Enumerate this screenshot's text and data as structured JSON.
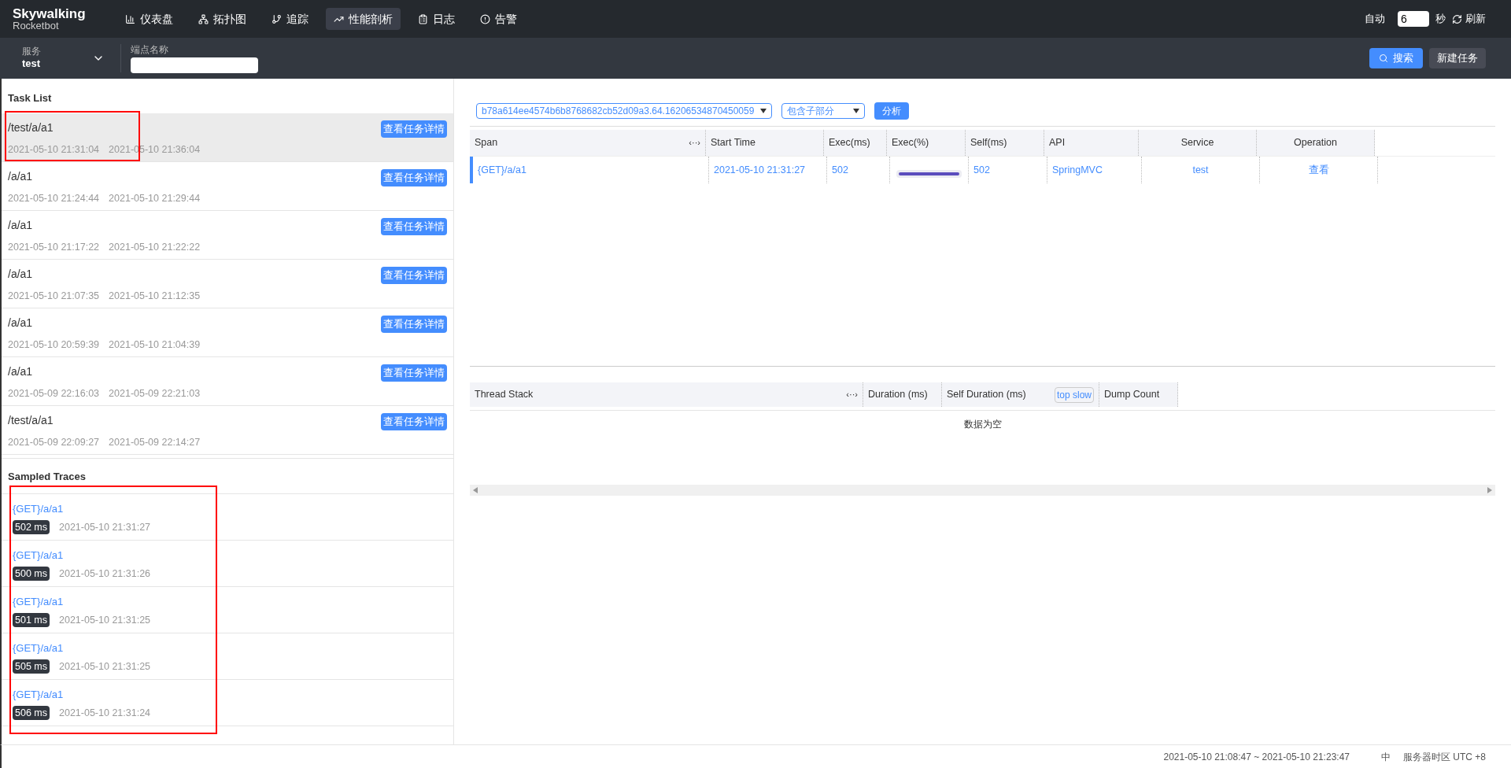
{
  "brand": {
    "name": "Skywalking",
    "subtitle": "Rocketbot"
  },
  "nav": [
    {
      "label": "仪表盘",
      "selected": false
    },
    {
      "label": "拓扑图",
      "selected": false
    },
    {
      "label": "追踪",
      "selected": false
    },
    {
      "label": "性能剖析",
      "selected": true
    },
    {
      "label": "日志",
      "selected": false
    },
    {
      "label": "告警",
      "selected": false
    }
  ],
  "auto_refresh": {
    "label": "自动",
    "value": "6",
    "unit": "秒",
    "refresh": "刷新"
  },
  "filters": {
    "service_label": "服务",
    "service_value": "test",
    "endpoint_label": "端点名称"
  },
  "actions": {
    "search": "搜索",
    "new_task": "新建任务"
  },
  "task_list": {
    "title": "Task List",
    "items": [
      {
        "endpoint": "/test/a/a1",
        "start": "2021-05-10 21:31:04",
        "end": "2021-05-10 21:36:04",
        "button": "查看任务详情",
        "selected": true
      },
      {
        "endpoint": "/a/a1",
        "start": "2021-05-10 21:24:44",
        "end": "2021-05-10 21:29:44",
        "button": "查看任务详情",
        "selected": false
      },
      {
        "endpoint": "/a/a1",
        "start": "2021-05-10 21:17:22",
        "end": "2021-05-10 21:22:22",
        "button": "查看任务详情",
        "selected": false
      },
      {
        "endpoint": "/a/a1",
        "start": "2021-05-10 21:07:35",
        "end": "2021-05-10 21:12:35",
        "button": "查看任务详情",
        "selected": false
      },
      {
        "endpoint": "/a/a1",
        "start": "2021-05-10 20:59:39",
        "end": "2021-05-10 21:04:39",
        "button": "查看任务详情",
        "selected": false
      },
      {
        "endpoint": "/a/a1",
        "start": "2021-05-09 22:16:03",
        "end": "2021-05-09 22:21:03",
        "button": "查看任务详情",
        "selected": false
      },
      {
        "endpoint": "/test/a/a1",
        "start": "2021-05-09 22:09:27",
        "end": "2021-05-09 22:14:27",
        "button": "查看任务详情",
        "selected": false
      }
    ]
  },
  "sampled_traces": {
    "title": "Sampled Traces",
    "items": [
      {
        "name": "{GET}/a/a1",
        "duration": "502 ms",
        "time": "2021-05-10 21:31:27"
      },
      {
        "name": "{GET}/a/a1",
        "duration": "500 ms",
        "time": "2021-05-10 21:31:26"
      },
      {
        "name": "{GET}/a/a1",
        "duration": "501 ms",
        "time": "2021-05-10 21:31:25"
      },
      {
        "name": "{GET}/a/a1",
        "duration": "505 ms",
        "time": "2021-05-10 21:31:25"
      },
      {
        "name": "{GET}/a/a1",
        "duration": "506 ms",
        "time": "2021-05-10 21:31:24"
      }
    ]
  },
  "analysis": {
    "segment": "b78a614ee4574b6b8768682cb52d09a3.64.16206534870450059",
    "mode": "包含子部分",
    "button": "分析"
  },
  "span_table": {
    "columns": [
      "Span",
      "Start Time",
      "Exec(ms)",
      "Exec(%)",
      "Self(ms)",
      "API",
      "Service",
      "Operation"
    ],
    "toggle": "‹··›",
    "rows": [
      {
        "span": "{GET}/a/a1",
        "start_time": "2021-05-10 21:31:27",
        "exec_ms": "502",
        "level": 1,
        "self_ms": "502",
        "api": "SpringMVC",
        "service": "test",
        "operation": "查看"
      }
    ]
  },
  "thread_table": {
    "columns": [
      "Thread Stack",
      "Duration (ms)",
      "Self Duration (ms)",
      "Dump Count"
    ],
    "toggle": "‹··›",
    "sort_button": "top slow",
    "empty": "数据为空"
  },
  "footer": {
    "range": "2021-05-10 21:08:47 ~ 2021-05-10 21:23:47",
    "lang": "中",
    "timezone": "服务器时区 UTC +8"
  }
}
